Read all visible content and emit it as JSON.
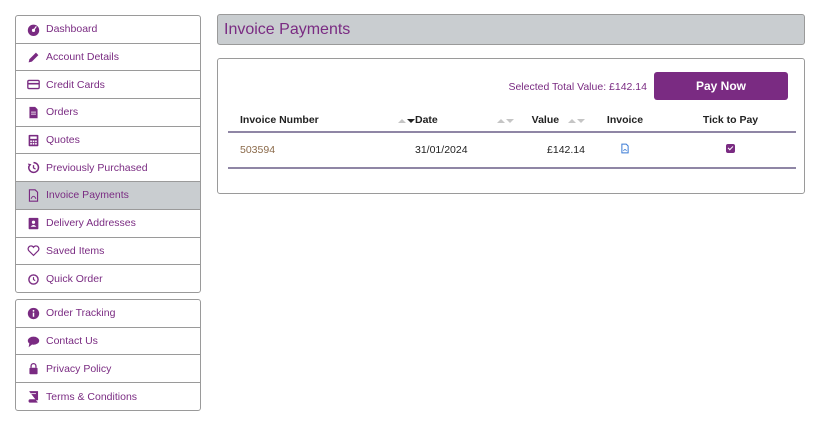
{
  "sidebar": {
    "primary": [
      {
        "label": "Dashboard",
        "icon": "dashboard-icon"
      },
      {
        "label": "Account Details",
        "icon": "pencil-icon"
      },
      {
        "label": "Credit Cards",
        "icon": "credit-card-icon"
      },
      {
        "label": "Orders",
        "icon": "document-icon"
      },
      {
        "label": "Quotes",
        "icon": "calculator-icon"
      },
      {
        "label": "Previously Purchased",
        "icon": "history-icon"
      },
      {
        "label": "Invoice Payments",
        "icon": "pdf-icon",
        "active": true
      },
      {
        "label": "Delivery Addresses",
        "icon": "address-book-icon"
      },
      {
        "label": "Saved Items",
        "icon": "heart-icon"
      },
      {
        "label": "Quick Order",
        "icon": "clock-icon"
      }
    ],
    "secondary": [
      {
        "label": "Order Tracking",
        "icon": "info-icon"
      },
      {
        "label": "Contact Us",
        "icon": "chat-icon"
      },
      {
        "label": "Privacy Policy",
        "icon": "lock-icon"
      },
      {
        "label": "Terms & Conditions",
        "icon": "book-icon"
      }
    ]
  },
  "page": {
    "title": "Invoice Payments",
    "selected_total": "Selected Total Value: £142.14",
    "pay_button": "Pay Now"
  },
  "table": {
    "headers": {
      "invoice_number": "Invoice Number",
      "date": "Date",
      "value": "Value",
      "invoice": "Invoice",
      "tick": "Tick to Pay"
    },
    "rows": [
      {
        "invoice_number": "503594",
        "date": "31/01/2024",
        "value": "£142.14",
        "invoice_icon": "pdf-icon",
        "ticked": true
      }
    ]
  },
  "colors": {
    "accent": "#7a2b82",
    "active_bg": "#c9cdd0"
  }
}
